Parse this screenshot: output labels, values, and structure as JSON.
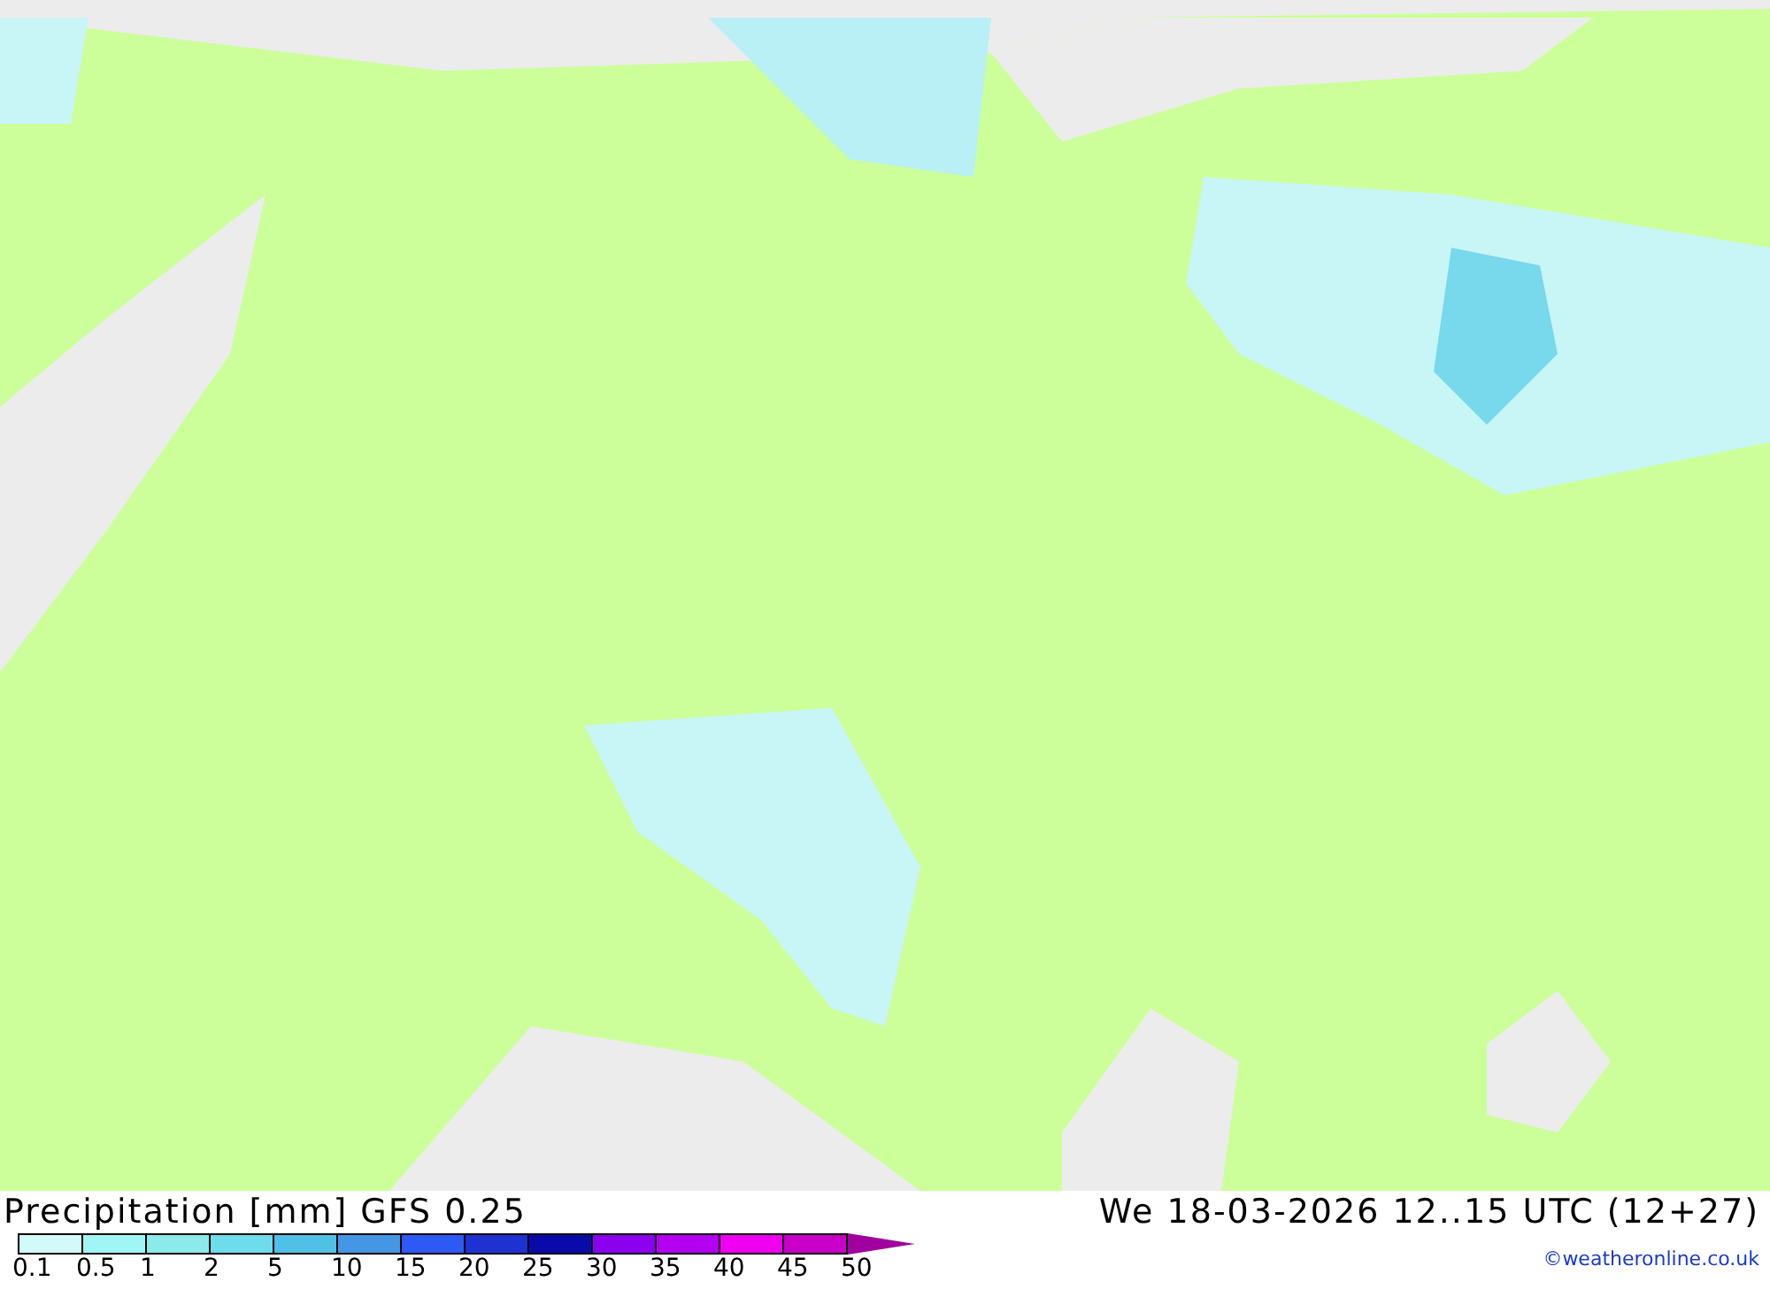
{
  "title": "Precipitation [mm] GFS 0.25",
  "datetime": "We 18-03-2026 12..15 UTC (12+27)",
  "legend": {
    "swatches": [
      {
        "color": "#d2fafa"
      },
      {
        "color": "#a0f5f5"
      },
      {
        "color": "#8ceaea"
      },
      {
        "color": "#6edcea"
      },
      {
        "color": "#50c0e6"
      },
      {
        "color": "#4696e6"
      },
      {
        "color": "#2d5af5"
      },
      {
        "color": "#1e32d2"
      },
      {
        "color": "#0a0aaa"
      },
      {
        "color": "#8c00f0"
      },
      {
        "color": "#b400f0"
      },
      {
        "color": "#f000f0"
      },
      {
        "color": "#c800c8"
      },
      {
        "kind": "arrow",
        "color": "#a000a0"
      }
    ],
    "labels": [
      "0.1",
      "0.5",
      "1",
      "2",
      "5",
      "10",
      "15",
      "20",
      "25",
      "30",
      "35",
      "40",
      "45",
      "50"
    ]
  },
  "credit": "©weatheronline.co.uk"
}
